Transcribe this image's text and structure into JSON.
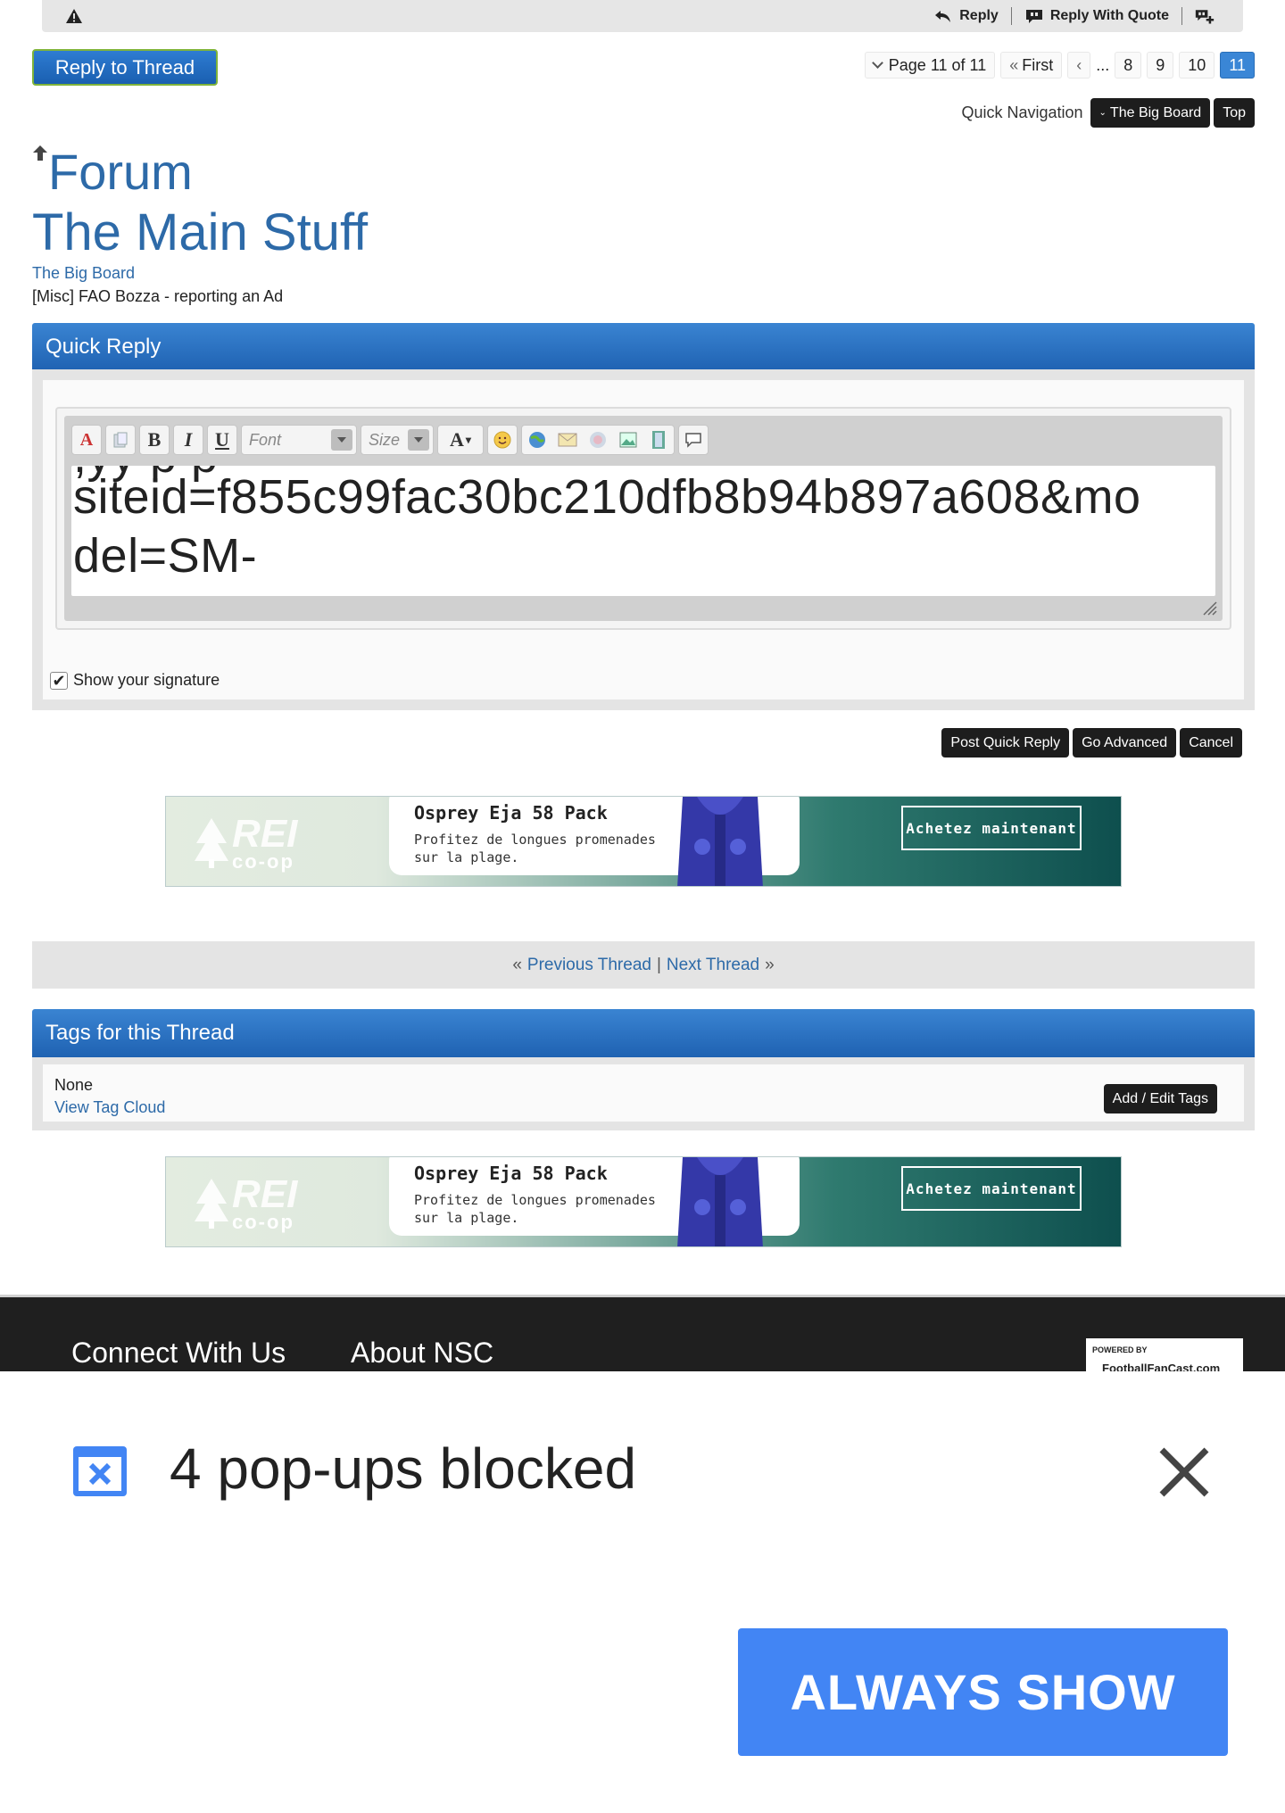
{
  "post_footer": {
    "reply": "Reply",
    "reply_with_quote": "Reply With Quote"
  },
  "reply_to_thread": "Reply to Thread",
  "pagination": {
    "label": "Page 11 of 11",
    "first": "First",
    "ellipsis": "...",
    "pages": [
      "8",
      "9",
      "10"
    ],
    "current": "11"
  },
  "quick_nav": {
    "label": "Quick Navigation",
    "board": "The Big Board",
    "top": "Top"
  },
  "breadcrumb": {
    "forum": "Forum",
    "section": "The Main Stuff",
    "board": "The Big Board",
    "thread": "[Misc] FAO Bozza - reporting an Ad"
  },
  "quick_reply": {
    "title": "Quick Reply",
    "font_placeholder": "Font",
    "size_placeholder": "Size",
    "text_line_1": "siteid=f855c99fac30bc210dfb8b94b897a608&mo",
    "text_line_2": "del=SM-",
    "show_signature": "Show your signature",
    "post_button": "Post Quick Reply",
    "advanced_button": "Go Advanced",
    "cancel_button": "Cancel"
  },
  "ad": {
    "brand": "REI",
    "brand_sub": "co-op",
    "product": "Osprey Eja 58 Pack",
    "tagline": "Profitez de longues promenades sur la plage.",
    "cta": "Achetez maintenant"
  },
  "thread_nav": {
    "prev": "Previous Thread",
    "next": "Next Thread",
    "laquo": "«",
    "raquo": "»",
    "sep": "|"
  },
  "tags": {
    "title": "Tags for this Thread",
    "none": "None",
    "view_cloud": "View Tag Cloud",
    "edit_button": "Add / Edit Tags"
  },
  "footer": {
    "connect": "Connect With Us",
    "about": "About NSC",
    "powered_by": "POWERED BY",
    "ffc": "FootballFanCast.com"
  },
  "popup": {
    "message": "4 pop-ups blocked",
    "always_show": "ALWAYS SHOW"
  },
  "colors": {
    "link_blue": "#2d6aa8",
    "header_blue": "#1f62b2",
    "chrome_button_blue": "#4285f4"
  }
}
